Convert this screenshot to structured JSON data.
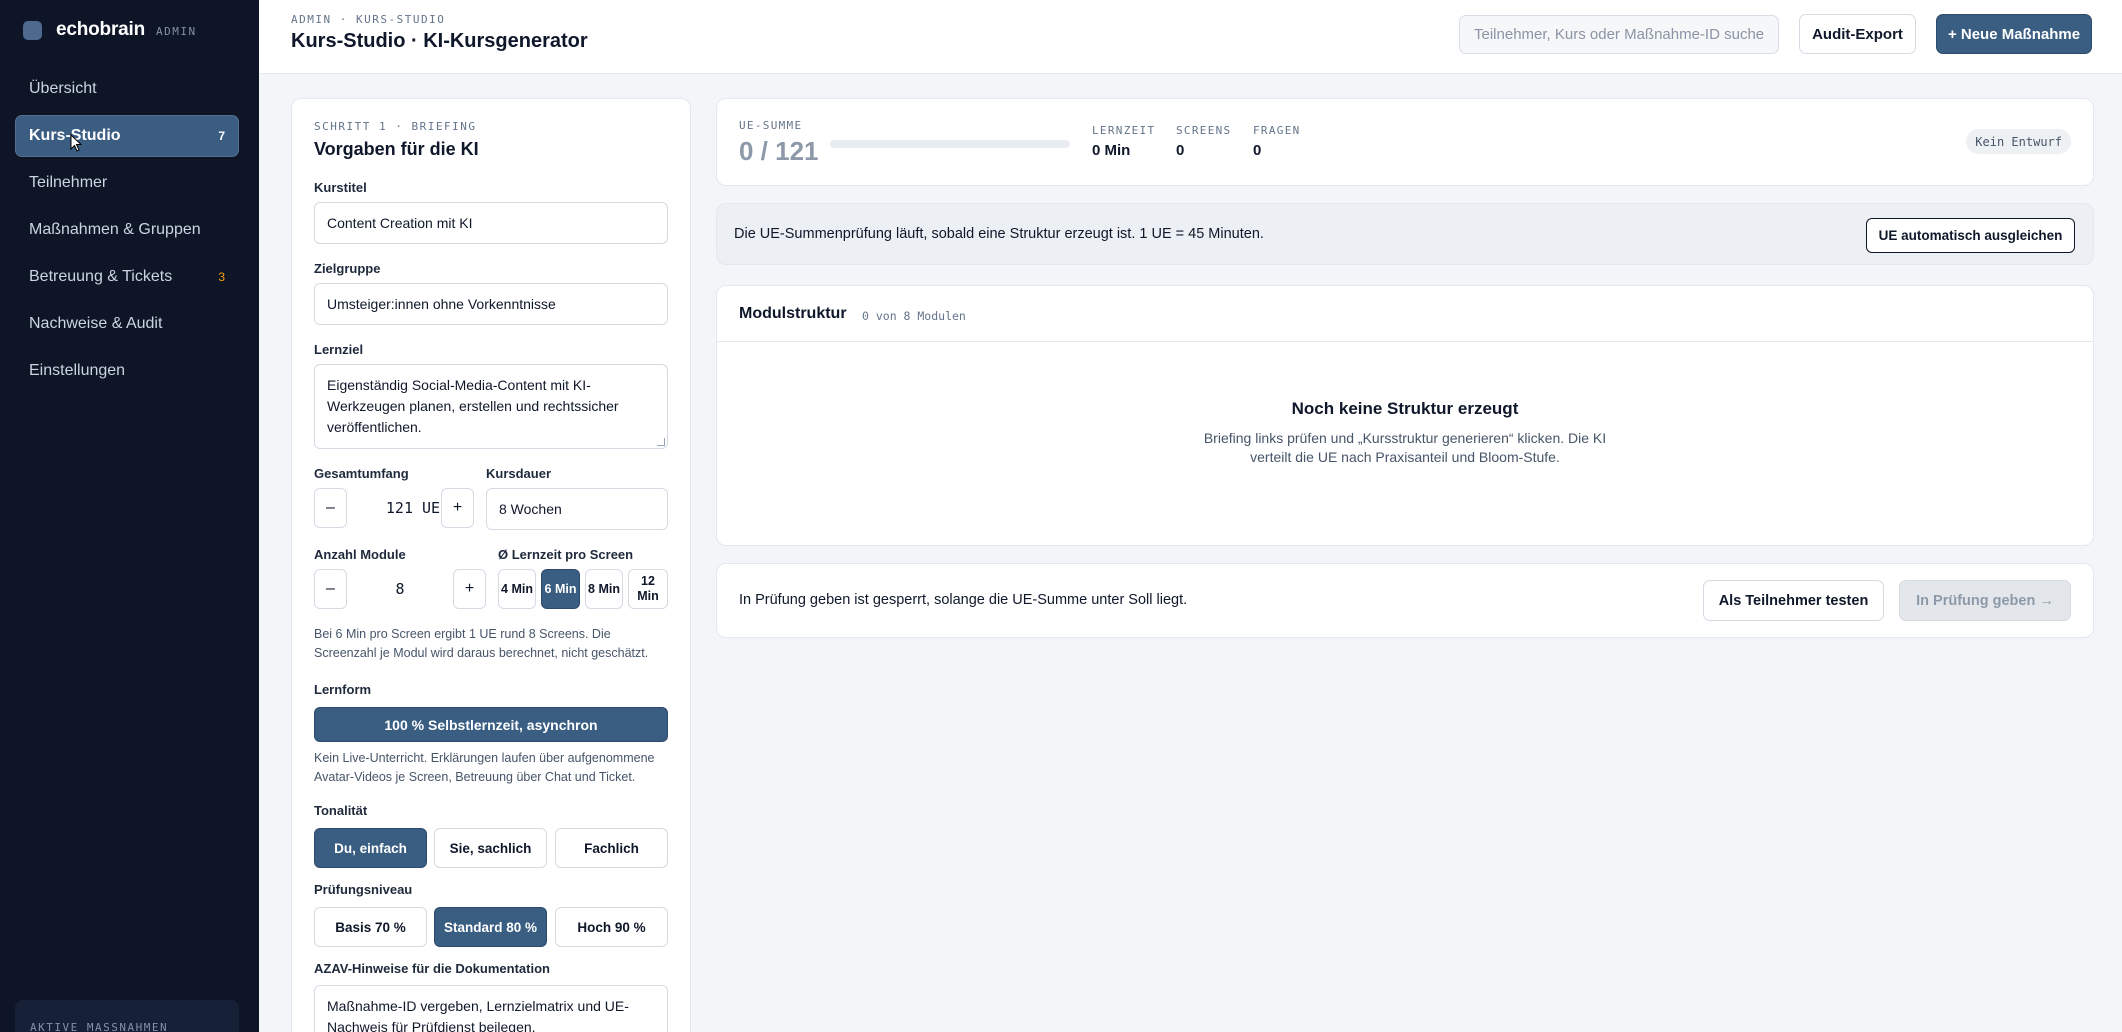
{
  "sidebar": {
    "brand": "echobrain",
    "brand_tag": "ADMIN",
    "items": [
      {
        "label": "Übersicht",
        "count": ""
      },
      {
        "label": "Kurs-Studio",
        "count": "7"
      },
      {
        "label": "Teilnehmer",
        "count": ""
      },
      {
        "label": "Maßnahmen & Gruppen",
        "count": ""
      },
      {
        "label": "Betreuung & Tickets",
        "count": "3"
      },
      {
        "label": "Nachweise & Audit",
        "count": ""
      },
      {
        "label": "Einstellungen",
        "count": ""
      }
    ],
    "footer_label": "AKTIVE MASSNAHMEN"
  },
  "header": {
    "breadcrumb": "ADMIN · KURS-STUDIO",
    "title": "Kurs-Studio · KI-Kursgenerator",
    "search_placeholder": "Teilnehmer, Kurs oder Maßnahme-ID suchen",
    "audit_export": "Audit-Export",
    "new_measure": "+ Neue Maßnahme"
  },
  "briefing": {
    "step": "SCHRITT 1 · BRIEFING",
    "title": "Vorgaben für die KI",
    "course_title_label": "Kurstitel",
    "course_title_value": "Content Creation mit KI",
    "audience_label": "Zielgruppe",
    "audience_value": "Umsteiger:innen ohne Vorkenntnisse",
    "goal_label": "Lernziel",
    "goal_value": "Eigenständig Social-Media-Content mit KI-Werkzeugen planen, erstellen und rechtssicher veröffentlichen.",
    "scope_label": "Gesamtumfang",
    "scope_minus": "–",
    "scope_value": "121 UE",
    "scope_plus": "+",
    "duration_label": "Kursdauer",
    "duration_value": "8 Wochen",
    "modules_label": "Anzahl Module",
    "modules_minus": "–",
    "modules_value": "8",
    "modules_plus": "+",
    "screen_time_label": "Ø Lernzeit pro Screen",
    "screen_time_options": [
      {
        "line1": "4 Min",
        "line2": "",
        "selected": false
      },
      {
        "line1": "6 Min",
        "line2": "",
        "selected": true
      },
      {
        "line1": "8 Min",
        "line2": "",
        "selected": false
      },
      {
        "line1": "12",
        "line2": "Min",
        "selected": false
      }
    ],
    "screen_hint": "Bei 6 Min pro Screen ergibt 1 UE rund 8 Screens. Die Screenzahl je Modul wird daraus berechnet, nicht geschätzt.",
    "learnform_label": "Lernform",
    "learnform_value": "100 % Selbstlernzeit, asynchron",
    "learnform_hint": "Kein Live-Unterricht. Erklärungen laufen über aufgenommene Avatar-Videos je Screen, Betreuung über Chat und Ticket.",
    "tone_label": "Tonalität",
    "tone_options": [
      {
        "label": "Du, einfach",
        "selected": true
      },
      {
        "label": "Sie, sachlich",
        "selected": false
      },
      {
        "label": "Fachlich",
        "selected": false
      }
    ],
    "exam_label": "Prüfungsniveau",
    "exam_options": [
      {
        "label": "Basis 70 %",
        "selected": false
      },
      {
        "label": "Standard 80 %",
        "selected": true
      },
      {
        "label": "Hoch 90 %",
        "selected": false
      }
    ],
    "azav_label": "AZAV-Hinweise für die Dokumentation",
    "azav_value": "Maßnahme-ID vergeben, Lernzielmatrix und UE-Nachweis für Prüfdienst beilegen."
  },
  "summary": {
    "ue_kicker": "UE-SUMME",
    "ue_value": "0 / 121",
    "ue_progress": 0,
    "lernzeit_kicker": "LERNZEIT",
    "lernzeit_value": "0 Min",
    "screens_kicker": "SCREENS",
    "screens_value": "0",
    "fragen_kicker": "FRAGEN",
    "fragen_value": "0",
    "draft_badge": "Kein Entwurf"
  },
  "notice": {
    "text": "Die UE-Summenprüfung läuft, sobald eine Struktur erzeugt ist. 1 UE = 45 Minuten.",
    "button": "UE automatisch ausgleichen"
  },
  "modules": {
    "title": "Modulstruktur",
    "count": "0 von 8 Modulen",
    "empty_title": "Noch keine Struktur erzeugt",
    "empty_line1": "Briefing links prüfen und „Kursstruktur generieren“ klicken. Die KI",
    "empty_line2": "verteilt die UE nach Praxisanteil und Bloom-Stufe."
  },
  "footer": {
    "text": "In Prüfung geben ist gesperrt, solange die UE-Summe unter Soll liegt.",
    "test_button": "Als Teilnehmer testen",
    "submit_button": "In Prüfung geben →"
  }
}
